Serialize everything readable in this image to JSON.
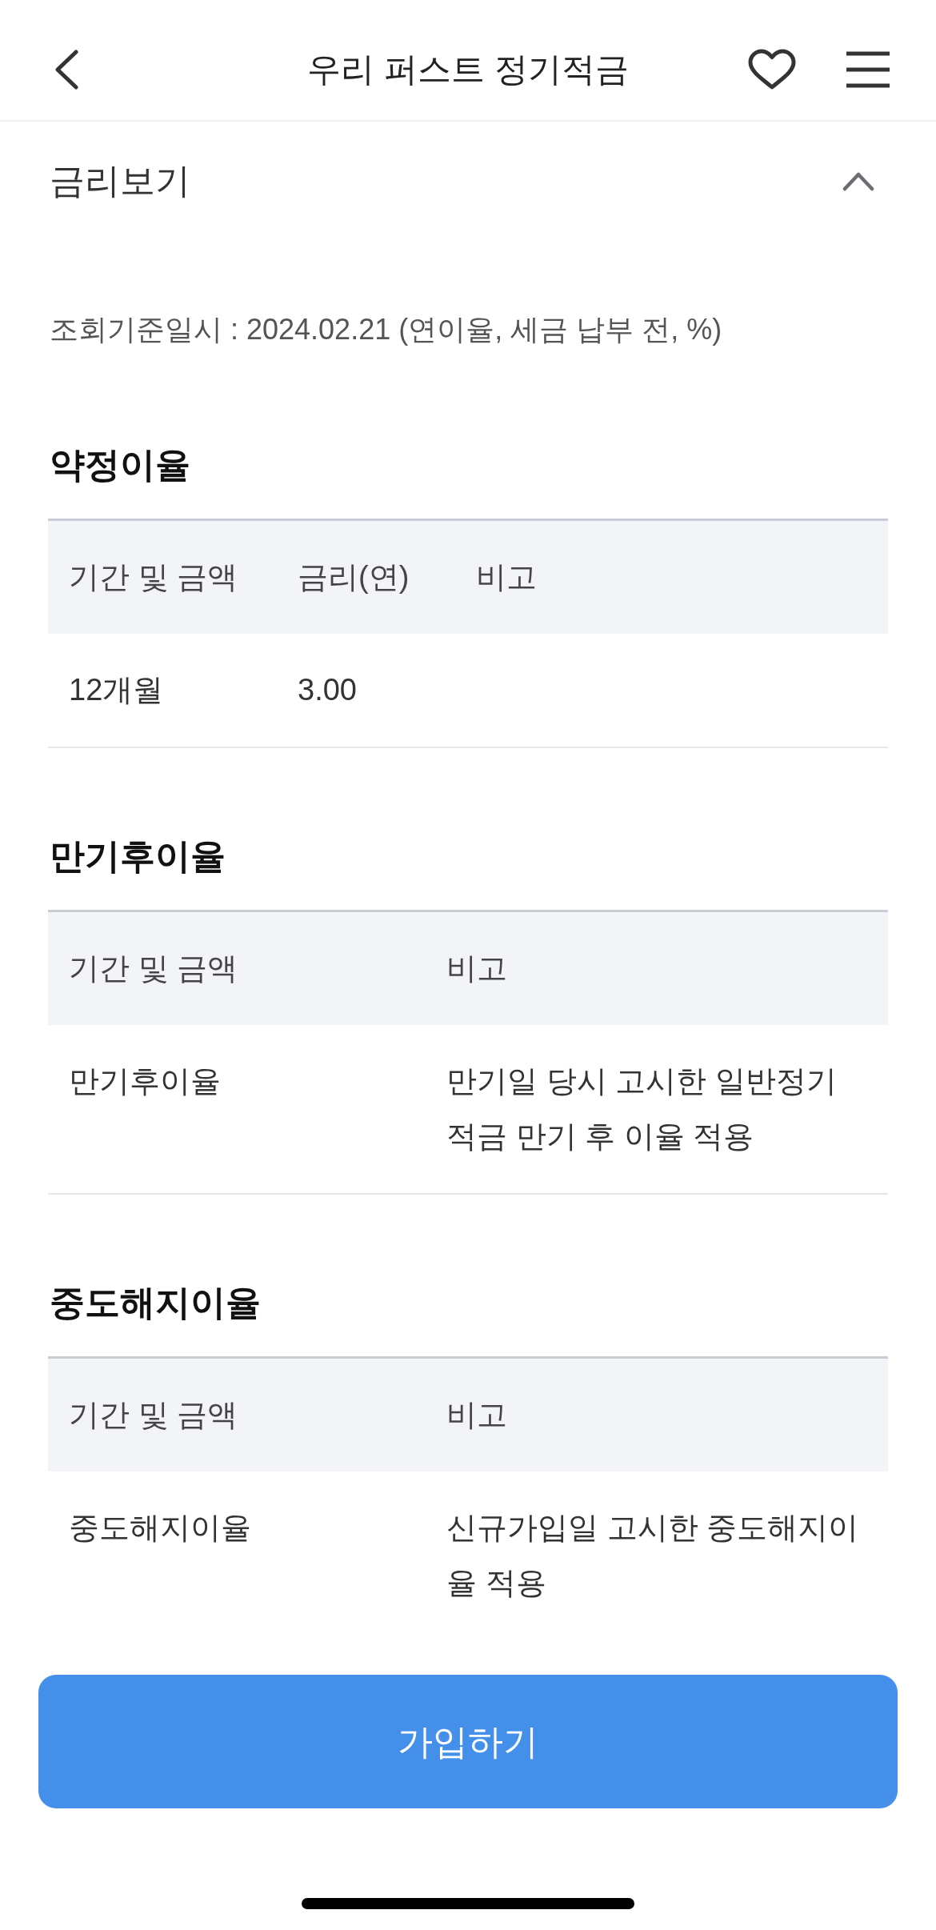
{
  "header": {
    "title": "우리 퍼스트 정기적금"
  },
  "section": {
    "title": "금리보기",
    "expanded": true
  },
  "notice": "조회기준일시 : 2024.02.21 (연이율, 세금 납부 전, %)",
  "tables": [
    {
      "title": "약정이율",
      "columns": [
        "기간 및 금액",
        "금리(연)",
        "비고"
      ],
      "rows": [
        [
          "12개월",
          "3.00"
        ]
      ]
    },
    {
      "title": "만기후이율",
      "columns": [
        "기간 및 금액",
        "비고"
      ],
      "rows": [
        [
          "만기후이율",
          "만기일 당시 고시한 일반정기 적금 만기 후 이율 적용"
        ]
      ]
    },
    {
      "title": "중도해지이율",
      "columns": [
        "기간 및 금액",
        "비고"
      ],
      "rows": [
        [
          "중도해지이율",
          "신규가입일 고시한 중도해지이율 적용"
        ]
      ]
    }
  ],
  "button": {
    "label": "가입하기"
  }
}
